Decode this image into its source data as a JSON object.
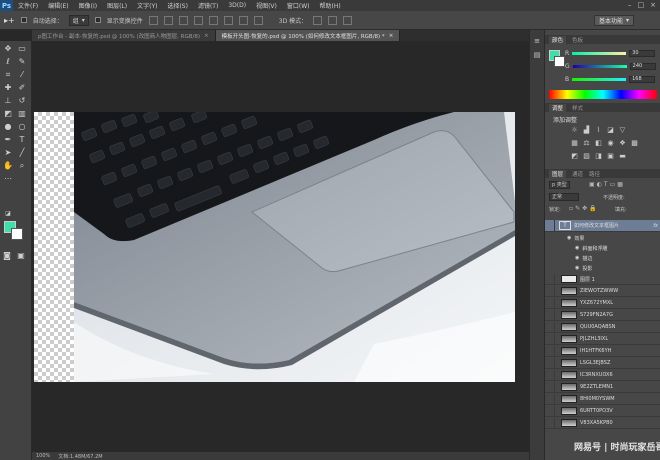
{
  "app": {
    "logo": "Ps"
  },
  "menu": [
    "文件(F)",
    "编辑(E)",
    "图像(I)",
    "图层(L)",
    "文字(Y)",
    "选择(S)",
    "滤镜(T)",
    "3D(D)",
    "视图(V)",
    "窗口(W)",
    "帮助(H)"
  ],
  "window_controls": [
    "–",
    "□",
    "×"
  ],
  "options_bar": {
    "auto_select_label": "自动选择：",
    "auto_select_value": "组",
    "show_transform_label": "显示变换控件",
    "mode_3d_label": "3D 模式：",
    "workspace": "基本功能"
  },
  "tabs": [
    {
      "label": "p图工作台 - 副本-恢复的.psd @ 100% (改图商人物图层, RGB/8)",
      "active": false
    },
    {
      "label": "模板开头图-恢复的.psd @ 100% (如何修改文本框图片, RGB/8) *",
      "active": true
    }
  ],
  "tab_close": "×",
  "status": {
    "zoom": "100%",
    "doc": "文档:1.48M/67.2M"
  },
  "color_panel": {
    "tabs": [
      "颜色",
      "色板"
    ],
    "foreground": "#3fe0a8",
    "background": "#ffffff",
    "channels": [
      {
        "label": "R",
        "value": "30"
      },
      {
        "label": "G",
        "value": "240"
      },
      {
        "label": "B",
        "value": "168"
      }
    ]
  },
  "adjust_panel": {
    "tabs": [
      "调整",
      "样式"
    ],
    "title": "添加调整"
  },
  "layers_panel": {
    "tabs": [
      "图层",
      "通道",
      "路径"
    ],
    "filter_label": "p 类型",
    "blend_mode": "正常",
    "opacity_label": "不透明度:",
    "lock_label": "锁定:",
    "fill_label": "填充:",
    "layers": [
      {
        "name": "如何修改文本框图片",
        "selected": true,
        "fx": true
      },
      {
        "name": "效果",
        "sub": true
      },
      {
        "name": "斜面和浮雕",
        "sub": true
      },
      {
        "name": "描边",
        "sub": true
      },
      {
        "name": "投影",
        "sub": true
      },
      {
        "name": "图层 1"
      },
      {
        "name": "ZIEWOTZWWW"
      },
      {
        "name": "YXZ672YMXL"
      },
      {
        "name": "S729FN2A7G"
      },
      {
        "name": "QUU0AQABSN"
      },
      {
        "name": "PJLZHL3IXL"
      },
      {
        "name": "IH1HTFK6YH"
      },
      {
        "name": "LSGL3EJBSZ"
      },
      {
        "name": "IC3RNXUOX6"
      },
      {
        "name": "9E2ZTLEMN1"
      },
      {
        "name": "8HI0M0YSWM"
      },
      {
        "name": "6URTT0PO3V"
      },
      {
        "name": "V83XA5KPB0"
      }
    ]
  },
  "watermark": "网易号 | 时尚玩家岳哥"
}
